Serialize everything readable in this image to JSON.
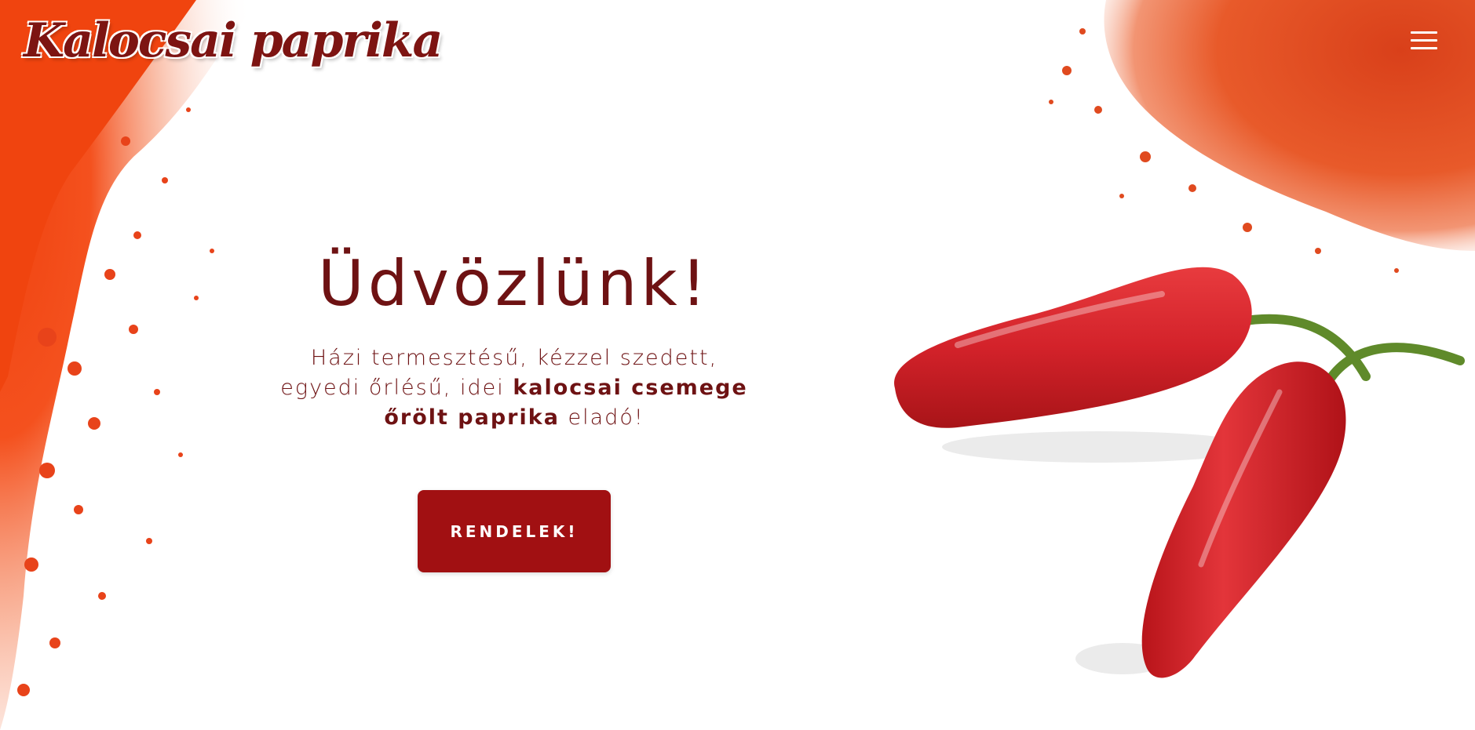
{
  "header": {
    "logo_text": "Kalocsai paprika",
    "menu_icon": "hamburger-menu-icon"
  },
  "hero": {
    "title": "Üdvözlünk!",
    "lead_part1": "Házi termesztésű, kézzel szedett, egyedi őrlésű, idei ",
    "lead_highlight": "kalocsai csemege őrölt paprika",
    "lead_part2": " eladó!",
    "cta_label": "RENDELEK!"
  },
  "colors": {
    "brand": "#6e1213",
    "button": "#a11012",
    "paprika": "#e8451d"
  }
}
